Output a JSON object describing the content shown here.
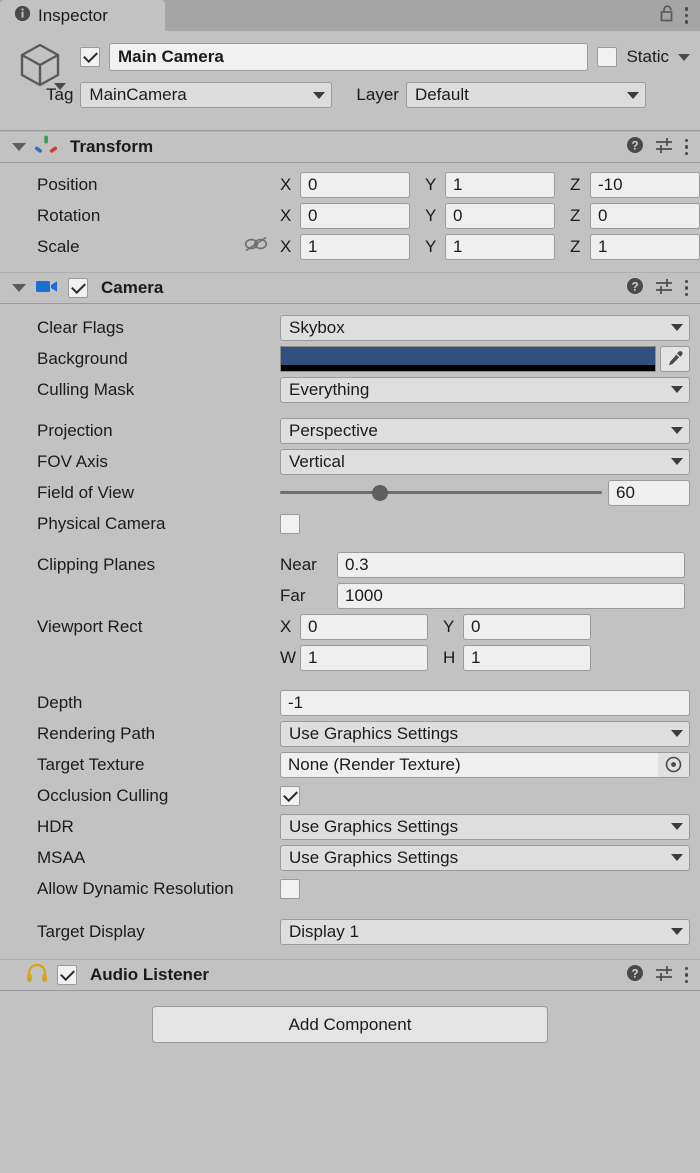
{
  "window": {
    "tab_label": "Inspector",
    "tab_icon": "info-icon",
    "lock_icon": "unlocked-padlock-icon",
    "menu_icon": "kebab-menu-icon"
  },
  "object_header": {
    "prefab_icon": "cube-icon",
    "enabled": true,
    "name": "Main Camera",
    "static_label": "Static",
    "static_checked": false,
    "tag_label": "Tag",
    "tag_value": "MainCamera",
    "layer_label": "Layer",
    "layer_value": "Default"
  },
  "components": [
    {
      "name": "Transform",
      "icon": "transform-gizmo-icon",
      "has_enable_toggle": false,
      "expanded": true,
      "rows": [
        {
          "label": "Position",
          "axes": [
            {
              "axis": "X",
              "value": "0"
            },
            {
              "axis": "Y",
              "value": "1"
            },
            {
              "axis": "Z",
              "value": "-10"
            }
          ]
        },
        {
          "label": "Rotation",
          "axes": [
            {
              "axis": "X",
              "value": "0"
            },
            {
              "axis": "Y",
              "value": "0"
            },
            {
              "axis": "Z",
              "value": "0"
            }
          ]
        },
        {
          "label": "Scale",
          "link_icon": "broken-link-icon",
          "axes": [
            {
              "axis": "X",
              "value": "1"
            },
            {
              "axis": "Y",
              "value": "1"
            },
            {
              "axis": "Z",
              "value": "1"
            }
          ]
        }
      ]
    },
    {
      "name": "Camera",
      "icon": "camera-icon",
      "has_enable_toggle": true,
      "enabled": true,
      "expanded": true
    },
    {
      "name": "Audio Listener",
      "icon": "headphones-icon",
      "has_enable_toggle": true,
      "enabled": true,
      "expanded": false
    }
  ],
  "camera": {
    "clear_flags": {
      "label": "Clear Flags",
      "value": "Skybox"
    },
    "background": {
      "label": "Background",
      "color": "#31507e",
      "alpha_color": "#000000",
      "picker_icon": "eyedropper-icon"
    },
    "culling_mask": {
      "label": "Culling Mask",
      "value": "Everything"
    },
    "projection": {
      "label": "Projection",
      "value": "Perspective"
    },
    "fov_axis": {
      "label": "FOV Axis",
      "value": "Vertical"
    },
    "field_of_view": {
      "label": "Field of View",
      "value": "60",
      "slider_percent": 31
    },
    "physical_camera": {
      "label": "Physical Camera",
      "checked": false
    },
    "clipping_planes": {
      "label": "Clipping Planes",
      "near_label": "Near",
      "near_value": "0.3",
      "far_label": "Far",
      "far_value": "1000"
    },
    "viewport_rect": {
      "label": "Viewport Rect",
      "x_label": "X",
      "x_value": "0",
      "y_label": "Y",
      "y_value": "0",
      "w_label": "W",
      "w_value": "1",
      "h_label": "H",
      "h_value": "1"
    },
    "depth": {
      "label": "Depth",
      "value": "-1"
    },
    "rendering_path": {
      "label": "Rendering Path",
      "value": "Use Graphics Settings"
    },
    "target_texture": {
      "label": "Target Texture",
      "value": "None (Render Texture)",
      "picker_icon": "object-picker-icon"
    },
    "occlusion_culling": {
      "label": "Occlusion Culling",
      "checked": true
    },
    "hdr": {
      "label": "HDR",
      "value": "Use Graphics Settings"
    },
    "msaa": {
      "label": "MSAA",
      "value": "Use Graphics Settings"
    },
    "allow_dynamic_resolution": {
      "label": "Allow Dynamic Resolution",
      "checked": false
    },
    "target_display": {
      "label": "Target Display",
      "value": "Display 1"
    }
  },
  "footer": {
    "add_component_label": "Add Component"
  },
  "header_icons": {
    "help_icon": "help-circle-icon",
    "preset_icon": "preset-sliders-icon",
    "menu_icon": "kebab-menu-icon"
  }
}
